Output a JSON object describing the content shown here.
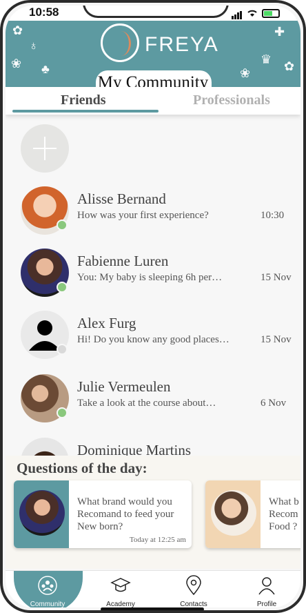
{
  "status_bar": {
    "time": "10:58"
  },
  "header": {
    "brand": "FREYA",
    "title": "My Community"
  },
  "tabs": [
    {
      "label": "Friends",
      "active": true
    },
    {
      "label": "Professionals",
      "active": false
    }
  ],
  "chats": [
    {
      "name": "Alisse Bernand",
      "message": "How was your first experience?",
      "time": "10:30",
      "online": true
    },
    {
      "name": "Fabienne Luren",
      "message": "You: My baby is sleeping 6h per…",
      "time": "15 Nov",
      "online": true
    },
    {
      "name": "Alex Furg",
      "message": "Hi! Do you know any good places…",
      "time": "15 Nov",
      "online": false
    },
    {
      "name": "Julie Vermeulen",
      "message": "Take a look at the course about…",
      "time": "6 Nov",
      "online": true
    },
    {
      "name": "Dominique Martins",
      "message": "",
      "time": "",
      "online": false
    }
  ],
  "questions": {
    "title": "Questions of the day:",
    "cards": [
      {
        "text": "What brand would you Recomand to feed your New born?",
        "time": "Today at 12:25 am"
      },
      {
        "text": "What b Recom Food ?",
        "time": ""
      }
    ]
  },
  "bottom_nav": [
    {
      "label": "Community",
      "icon": "community-icon",
      "active": true
    },
    {
      "label": "Academy",
      "icon": "graduation-cap-icon",
      "active": false
    },
    {
      "label": "Contacts",
      "icon": "location-pin-icon",
      "active": false
    },
    {
      "label": "Profile",
      "icon": "person-icon",
      "active": false
    }
  ],
  "colors": {
    "accent": "#5d9aa1",
    "online": "#8ac87d",
    "offline": "#d9d9d9",
    "card_peach": "#f2d6b3"
  }
}
